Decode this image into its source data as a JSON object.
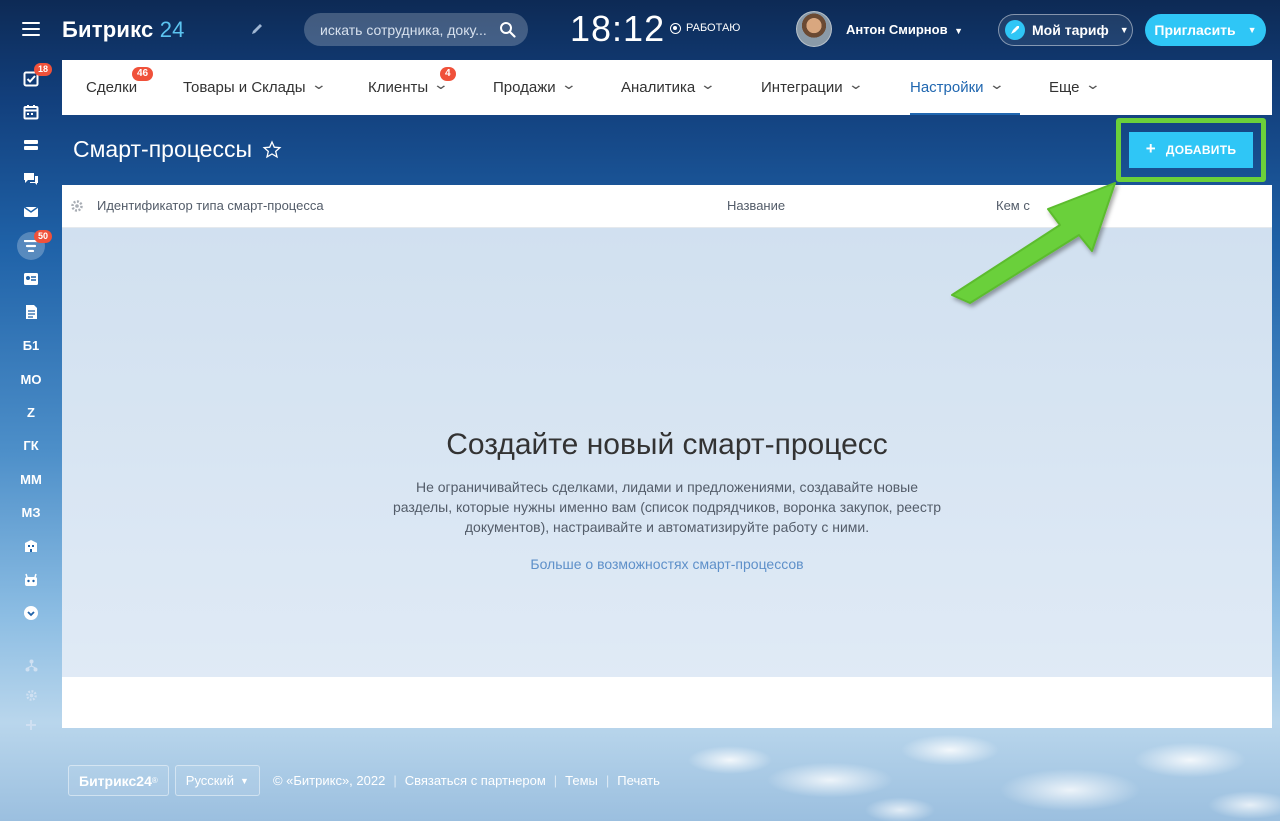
{
  "sidebar": {
    "items": [
      {
        "icon": "tasks-icon",
        "label": "",
        "badge": "18"
      },
      {
        "icon": "calendar-icon",
        "label": "",
        "badge": ""
      },
      {
        "icon": "drive-icon",
        "label": "",
        "badge": ""
      },
      {
        "icon": "chat-icon",
        "label": "",
        "badge": ""
      },
      {
        "icon": "mail-icon",
        "label": "",
        "badge": ""
      },
      {
        "icon": "crm-funnel-icon",
        "label": "",
        "badge": "50"
      },
      {
        "icon": "contact-center-icon",
        "label": "",
        "badge": ""
      },
      {
        "icon": "document-icon",
        "label": "",
        "badge": ""
      },
      {
        "icon": "",
        "label": "Б1",
        "badge": ""
      },
      {
        "icon": "",
        "label": "МО",
        "badge": ""
      },
      {
        "icon": "",
        "label": "Z",
        "badge": ""
      },
      {
        "icon": "",
        "label": "ГК",
        "badge": ""
      },
      {
        "icon": "",
        "label": "ММ",
        "badge": ""
      },
      {
        "icon": "",
        "label": "МЗ",
        "badge": ""
      },
      {
        "icon": "company-icon",
        "label": "",
        "badge": ""
      },
      {
        "icon": "robot-icon",
        "label": "",
        "badge": ""
      },
      {
        "icon": "more-icon",
        "label": "",
        "badge": ""
      }
    ]
  },
  "header": {
    "logo_text": "Битрикс",
    "logo_num": "24",
    "search_placeholder": "искать сотрудника, доку...",
    "clock": "18:12",
    "status": "РАБОТАЮ",
    "user_name": "Антон Смирнов",
    "tariff": "Мой тариф",
    "invite": "Пригласить"
  },
  "nav": {
    "tabs": [
      {
        "label": "Сделки",
        "badge": "46",
        "chevron": false,
        "active": false
      },
      {
        "label": "Товары и Склады",
        "badge": "",
        "chevron": true,
        "active": false
      },
      {
        "label": "Клиенты",
        "badge": "4",
        "chevron": true,
        "active": false
      },
      {
        "label": "Продажи",
        "badge": "",
        "chevron": true,
        "active": false
      },
      {
        "label": "Аналитика",
        "badge": "",
        "chevron": true,
        "active": false
      },
      {
        "label": "Интеграции",
        "badge": "",
        "chevron": true,
        "active": false
      },
      {
        "label": "Настройки",
        "badge": "",
        "chevron": true,
        "active": true
      },
      {
        "label": "Еще",
        "badge": "",
        "chevron": true,
        "active": false
      }
    ]
  },
  "page": {
    "title": "Смарт-процессы",
    "add_button": "ДОБАВИТЬ"
  },
  "grid": {
    "columns": [
      "Идентификатор типа смарт-процесса",
      "Название",
      "Кем с"
    ],
    "empty_title": "Создайте новый смарт-процесс",
    "empty_text": "Не ограничивайтесь сделками, лидами и предложениями, создавайте новые разделы, которые нужны именно вам (список подрядчиков, воронка закупок, реестр документов), настраивайте и автоматизируйте работу с ними.",
    "empty_link": "Больше о возможностях смарт-процессов"
  },
  "footer": {
    "logo": "Битрикс24",
    "lang": "Русский",
    "copyright": "© «Битрикс», 2022",
    "links": [
      "Связаться с партнером",
      "Темы",
      "Печать"
    ]
  },
  "colors": {
    "accent": "#2fc6f6",
    "active_tab": "#2067b0",
    "badge": "#f0513a",
    "highlight": "#6bd03a"
  }
}
